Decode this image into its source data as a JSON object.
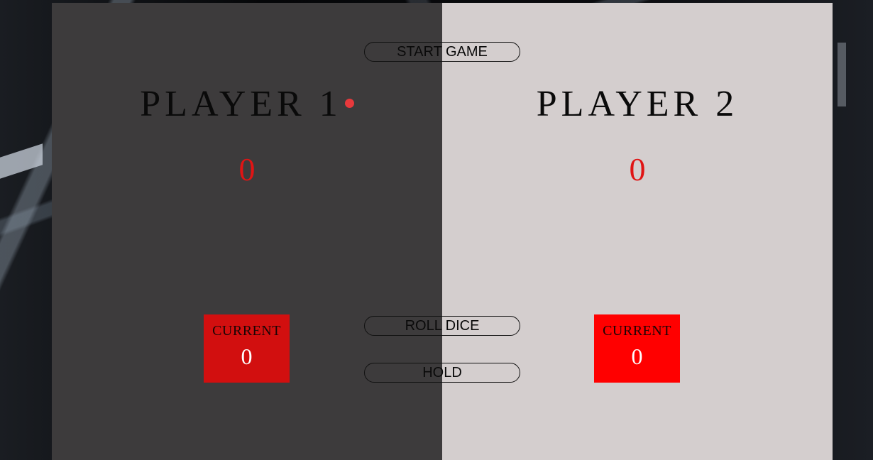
{
  "controls": {
    "start_label": "START GAME",
    "roll_label": "ROLL DICE",
    "hold_label": "HOLD"
  },
  "players": [
    {
      "name": "PLAYER 1",
      "active": true,
      "total_score": "0",
      "current_label": "CURRENT",
      "current_score": "0"
    },
    {
      "name": "PLAYER 2",
      "active": false,
      "total_score": "0",
      "current_label": "CURRENT",
      "current_score": "0"
    }
  ],
  "colors": {
    "panel_1_bg": "#3d3b3c",
    "panel_2_bg": "#d4cece",
    "score_red": "#e01414",
    "current_box_1": "#d20f0f",
    "current_box_2": "#ff0000",
    "active_dot": "#e8393c"
  },
  "icons": {
    "active_indicator": "active-player-dot-icon"
  }
}
